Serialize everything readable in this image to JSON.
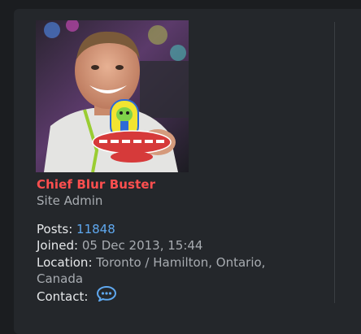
{
  "profile": {
    "username": "Chief Blur Buster",
    "rank": "Site Admin",
    "posts_label": "Posts:",
    "posts_value": "11848",
    "joined_label": "Joined:",
    "joined_value": "05 Dec 2013, 15:44",
    "location_label": "Location:",
    "location_value_line1": "Toronto / Hamilton, Ontario,",
    "location_value_line2": "Canada",
    "contact_label": "Contact:",
    "contact_icon": "speech-bubble-icon"
  },
  "colors": {
    "username": "#ff4f4f",
    "link": "#5fa8ef",
    "background": "#24272b"
  }
}
